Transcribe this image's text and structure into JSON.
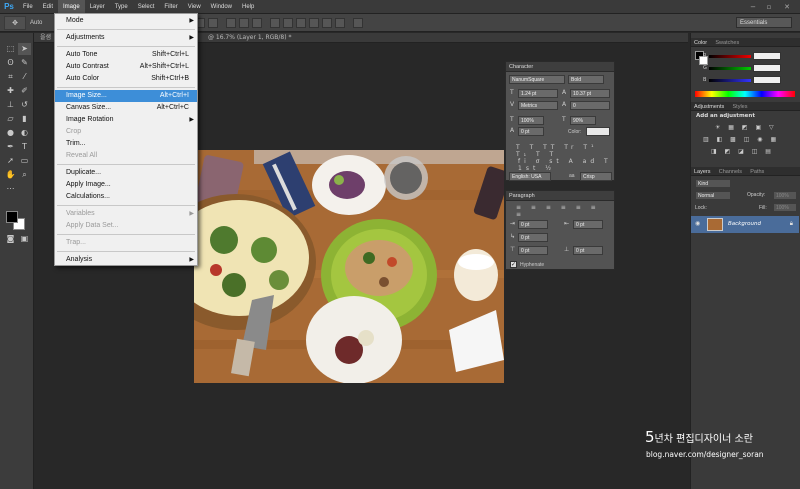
{
  "app": {
    "logo": "Ps"
  },
  "menubar": {
    "items": [
      "File",
      "Edit",
      "Image",
      "Layer",
      "Type",
      "Select",
      "Filter",
      "View",
      "Window",
      "Help"
    ],
    "active": "Image",
    "controls": [
      "−",
      "▫",
      "✕"
    ]
  },
  "optionsbar": {
    "auto_label": "Auto",
    "workspace": "Essentials"
  },
  "document": {
    "tab_label": "을샘",
    "tab_info": "@ 16.7% (Layer 1, RGB/8) *"
  },
  "image_menu": {
    "items": [
      {
        "label": "Mode",
        "shortcut": "",
        "submenu": true,
        "disabled": false,
        "highlight": false
      },
      {
        "label": "Adjustments",
        "shortcut": "",
        "submenu": true,
        "disabled": false,
        "highlight": false
      },
      {
        "label": "Auto Tone",
        "shortcut": "Shift+Ctrl+L",
        "submenu": false,
        "disabled": false,
        "highlight": false
      },
      {
        "label": "Auto Contrast",
        "shortcut": "Alt+Shift+Ctrl+L",
        "submenu": false,
        "disabled": false,
        "highlight": false
      },
      {
        "label": "Auto Color",
        "shortcut": "Shift+Ctrl+B",
        "submenu": false,
        "disabled": false,
        "highlight": false
      },
      {
        "label": "Image Size...",
        "shortcut": "Alt+Ctrl+I",
        "submenu": false,
        "disabled": false,
        "highlight": true
      },
      {
        "label": "Canvas Size...",
        "shortcut": "Alt+Ctrl+C",
        "submenu": false,
        "disabled": false,
        "highlight": false
      },
      {
        "label": "Image Rotation",
        "shortcut": "",
        "submenu": true,
        "disabled": false,
        "highlight": false
      },
      {
        "label": "Crop",
        "shortcut": "",
        "submenu": false,
        "disabled": true,
        "highlight": false
      },
      {
        "label": "Trim...",
        "shortcut": "",
        "submenu": false,
        "disabled": false,
        "highlight": false
      },
      {
        "label": "Reveal All",
        "shortcut": "",
        "submenu": false,
        "disabled": true,
        "highlight": false
      },
      {
        "label": "Duplicate...",
        "shortcut": "",
        "submenu": false,
        "disabled": false,
        "highlight": false
      },
      {
        "label": "Apply Image...",
        "shortcut": "",
        "submenu": false,
        "disabled": false,
        "highlight": false
      },
      {
        "label": "Calculations...",
        "shortcut": "",
        "submenu": false,
        "disabled": false,
        "highlight": false
      },
      {
        "label": "Variables",
        "shortcut": "",
        "submenu": true,
        "disabled": true,
        "highlight": false
      },
      {
        "label": "Apply Data Set...",
        "shortcut": "",
        "submenu": false,
        "disabled": true,
        "highlight": false
      },
      {
        "label": "Trap...",
        "shortcut": "",
        "submenu": false,
        "disabled": true,
        "highlight": false
      },
      {
        "label": "Analysis",
        "shortcut": "",
        "submenu": true,
        "disabled": false,
        "highlight": false
      }
    ]
  },
  "character_panel": {
    "title": "Character",
    "font_family": "NanumSquare",
    "font_style": "Bold",
    "font_size": "1.24 pt",
    "leading": "10.37 pt",
    "kerning": "Metrics",
    "tracking": "0",
    "vertical_scale": "100%",
    "horizontal_scale": "90%",
    "baseline_shift": "0 pt",
    "color_label": "Color:",
    "language": "English: USA",
    "aa_label": "aa",
    "antialias": "Crisp"
  },
  "paragraph_panel": {
    "title": "Paragraph",
    "indent_left": "0 pt",
    "indent_right": "0 pt",
    "indent_first": "0 pt",
    "space_before": "0 pt",
    "space_after": "0 pt",
    "hyphenate_label": "Hyphenate"
  },
  "right_panels": {
    "color_tabs": [
      "Color",
      "Swatches"
    ],
    "rgb_labels": [
      "R",
      "G",
      "B"
    ],
    "adjust_tabs": [
      "Adjustments",
      "Styles"
    ],
    "add_adjustment": "Add an adjustment",
    "layer_tabs": [
      "Layers",
      "Channels",
      "Paths"
    ],
    "kind": "Kind",
    "blend_mode": "Normal",
    "opacity_label": "Opacity:",
    "opacity_value": "100%",
    "lock_label": "Lock:",
    "fill_label": "Fill:",
    "fill_value": "100%",
    "layer_name": "Background"
  },
  "watermark": {
    "prefix": "5",
    "line1": "년차 편집디자이너 소란",
    "line2": "blog.naver.com/designer_soran"
  },
  "colors": {
    "menu_highlight": "#3d8ed8",
    "panel_bg": "#535353",
    "ui_dark": "#282828",
    "table_wood": "#a96a34",
    "green_plate": "#8db334"
  }
}
